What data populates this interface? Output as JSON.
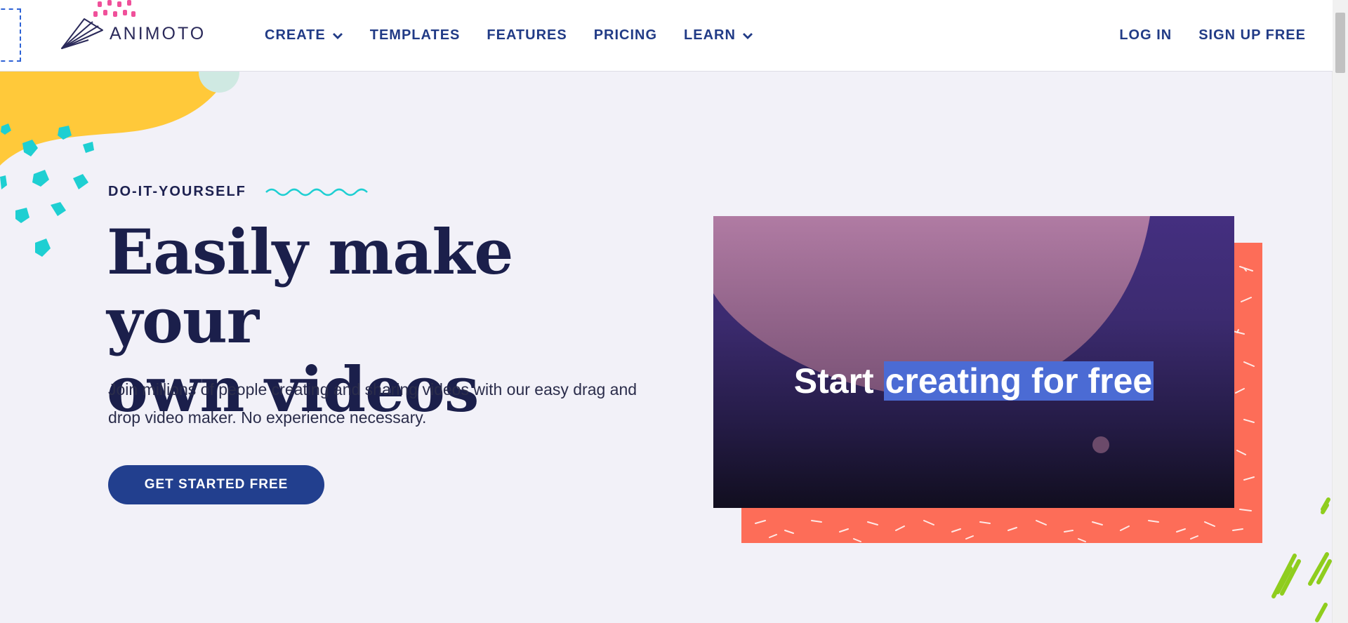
{
  "brand": {
    "name": "ANIMOTO"
  },
  "nav": {
    "items": [
      {
        "label": "CREATE",
        "has_dropdown": true
      },
      {
        "label": "TEMPLATES",
        "has_dropdown": false
      },
      {
        "label": "FEATURES",
        "has_dropdown": false
      },
      {
        "label": "PRICING",
        "has_dropdown": false
      },
      {
        "label": "LEARN",
        "has_dropdown": true
      }
    ],
    "login_label": "LOG IN",
    "signup_label": "SIGN UP FREE"
  },
  "hero": {
    "eyebrow": "DO-IT-YOURSELF",
    "headline_line1": "Easily make your",
    "headline_line2": "own videos",
    "subtext": "Join millions of people creating and sharing videos with our easy drag and drop video maker. No experience necessary.",
    "cta_label": "GET STARTED FREE"
  },
  "video": {
    "text_plain": "Start",
    "text_highlight": "creating for free"
  },
  "colors": {
    "nav_text": "#213b86",
    "headline": "#1b1f4b",
    "cta_bg": "#223f8e",
    "coral": "#fd6d58",
    "yellow": "#ffc93a",
    "teal": "#1ecfd2",
    "pink": "#f0509a",
    "video_highlight": "#4b6bd4"
  }
}
